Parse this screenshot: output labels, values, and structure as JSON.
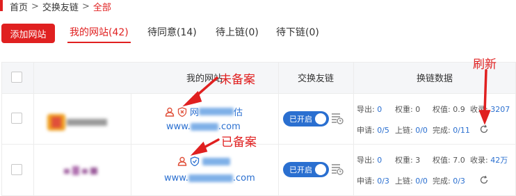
{
  "breadcrumb": {
    "home": "首页",
    "sep": ">",
    "exchange": "交换友链",
    "current": "全部"
  },
  "toolbar": {
    "add_label": "添加网站"
  },
  "tabs": [
    {
      "label": "我的网站(42)",
      "active": true
    },
    {
      "label": "待同意(14)",
      "active": false
    },
    {
      "label": "待上链(0)",
      "active": false
    },
    {
      "label": "待下链(0)",
      "active": false
    }
  ],
  "table": {
    "headers": {
      "site": "我的网站",
      "exchange": "交换友链",
      "data": "换链数据"
    },
    "rows": [
      {
        "name_prefix": "网",
        "name_suffix": "估",
        "url_prefix": "www.",
        "url_suffix": ".com",
        "record_status": "未备案",
        "toggle_label": "已开启",
        "stats": {
          "export_label": "导出:",
          "export": "0",
          "weight_label": "权重:",
          "weight": "0",
          "weight_value_label": "权值:",
          "weight_value": "0.9",
          "indexed_label": "收录:",
          "indexed": "3207",
          "apply_label": "申请:",
          "apply": "0/5",
          "online_label": "上链:",
          "online": "0/0",
          "done_label": "完成:",
          "done": "0/11"
        }
      },
      {
        "name_prefix": "",
        "name_suffix": "",
        "url_prefix": "www.",
        "url_suffix": ".com",
        "record_status": "已备案",
        "toggle_label": "已开启",
        "stats": {
          "export_label": "导出:",
          "export": "0",
          "weight_label": "权重:",
          "weight": "3",
          "weight_value_label": "权值:",
          "weight_value": "7.0",
          "indexed_label": "收录:",
          "indexed": "42万",
          "apply_label": "申请:",
          "apply": "0/3",
          "online_label": "上链:",
          "online": "0/0",
          "done_label": "完成:",
          "done": "0/3"
        }
      }
    ]
  },
  "annotations": {
    "unrecorded": "未备案",
    "recorded": "已备案",
    "refresh": "刷新"
  },
  "colors": {
    "accent": "#e02020",
    "link": "#2a6fd0",
    "header_bg": "#f5f6f8"
  }
}
